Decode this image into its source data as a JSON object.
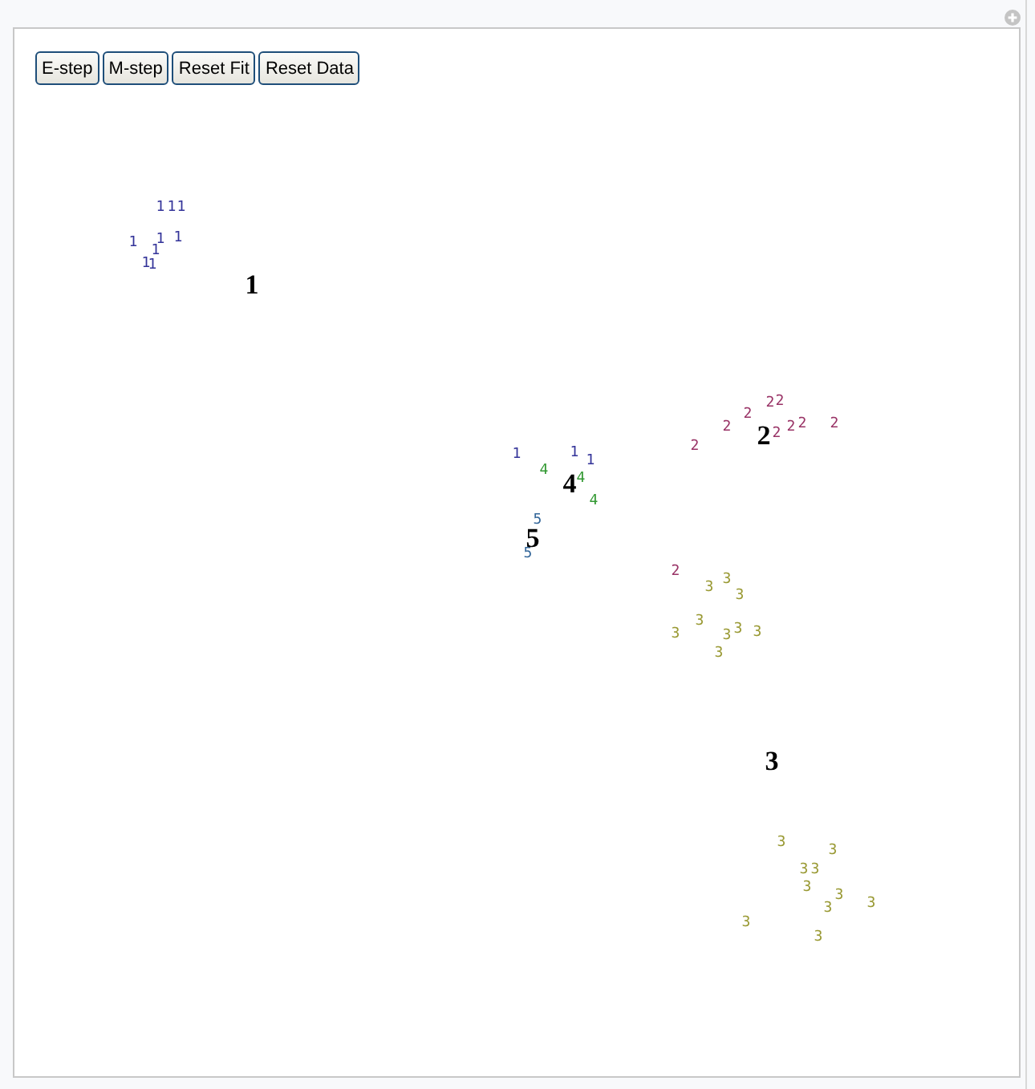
{
  "toolbar": {
    "buttons": [
      "E-step",
      "M-step",
      "Reset Fit",
      "Reset Data"
    ]
  },
  "plot": {
    "points": [
      {
        "label": "1",
        "color": "#333399"
      },
      {
        "label": "1",
        "color": "#333399"
      },
      {
        "label": "1",
        "color": "#333399"
      },
      {
        "label": "1",
        "color": "#333399"
      },
      {
        "label": "1",
        "color": "#333399"
      },
      {
        "label": "1",
        "color": "#333399"
      },
      {
        "label": "1",
        "color": "#333399"
      },
      {
        "label": "1",
        "color": "#333399"
      },
      {
        "label": "1",
        "color": "#333399"
      },
      {
        "label": "2",
        "color": "#993366"
      },
      {
        "label": "2",
        "color": "#993366"
      },
      {
        "label": "2",
        "color": "#993366"
      },
      {
        "label": "2",
        "color": "#993366"
      },
      {
        "label": "2",
        "color": "#993366"
      },
      {
        "label": "2",
        "color": "#993366"
      },
      {
        "label": "2",
        "color": "#993366"
      },
      {
        "label": "2",
        "color": "#993366"
      },
      {
        "label": "2",
        "color": "#993366"
      },
      {
        "label": "2",
        "color": "#993366"
      },
      {
        "label": "1",
        "color": "#333399"
      },
      {
        "label": "1",
        "color": "#333399"
      },
      {
        "label": "1",
        "color": "#333399"
      },
      {
        "label": "4",
        "color": "#339933"
      },
      {
        "label": "4",
        "color": "#339933"
      },
      {
        "label": "4",
        "color": "#339933"
      },
      {
        "label": "5",
        "color": "#336699"
      },
      {
        "label": "5",
        "color": "#336699"
      },
      {
        "label": "3",
        "color": "#999933"
      },
      {
        "label": "3",
        "color": "#999933"
      },
      {
        "label": "3",
        "color": "#999933"
      },
      {
        "label": "3",
        "color": "#999933"
      },
      {
        "label": "3",
        "color": "#999933"
      },
      {
        "label": "3",
        "color": "#999933"
      },
      {
        "label": "3",
        "color": "#999933"
      },
      {
        "label": "3",
        "color": "#999933"
      },
      {
        "label": "3",
        "color": "#999933"
      },
      {
        "label": "3",
        "color": "#999933"
      },
      {
        "label": "3",
        "color": "#999933"
      },
      {
        "label": "3",
        "color": "#999933"
      },
      {
        "label": "3",
        "color": "#999933"
      },
      {
        "label": "3",
        "color": "#999933"
      },
      {
        "label": "3",
        "color": "#999933"
      },
      {
        "label": "3",
        "color": "#999933"
      },
      {
        "label": "3",
        "color": "#999933"
      },
      {
        "label": "3",
        "color": "#999933"
      },
      {
        "label": "3",
        "color": "#999933"
      }
    ],
    "centroids": [
      {
        "label": "1"
      },
      {
        "label": "2"
      },
      {
        "label": "4"
      },
      {
        "label": "5"
      },
      {
        "label": "3"
      }
    ]
  }
}
